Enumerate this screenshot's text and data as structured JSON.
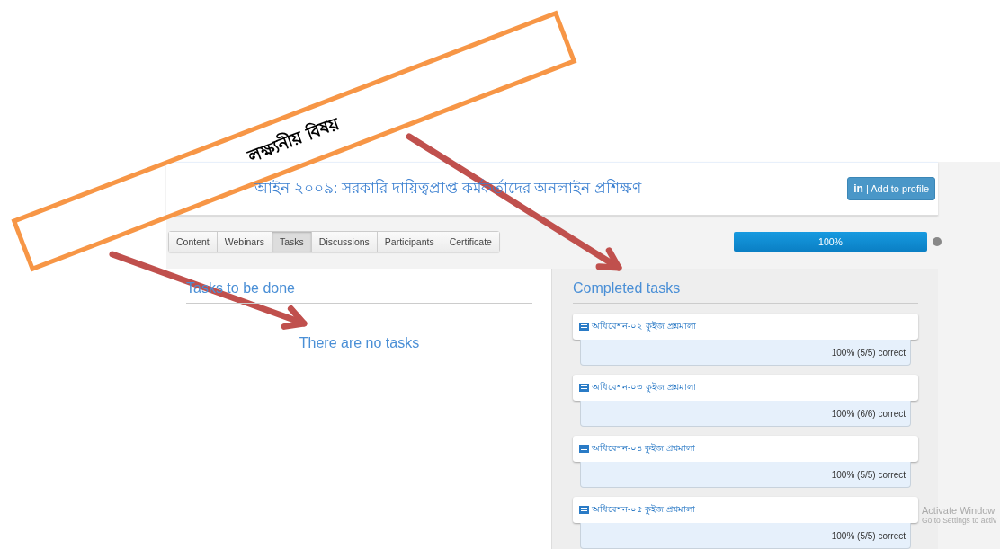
{
  "course": {
    "title": "আইন ২০০৯: সরকারি দায়িত্বপ্রাপ্ত কর্মকর্তাদের অনলাইন প্রশিক্ষণ",
    "profile_button": {
      "icon_text": "in",
      "label": "| Add to profile"
    }
  },
  "tabs": [
    {
      "label": "Content",
      "selected": false
    },
    {
      "label": "Webinars",
      "selected": false
    },
    {
      "label": "Tasks",
      "selected": true
    },
    {
      "label": "Discussions",
      "selected": false
    },
    {
      "label": "Participants",
      "selected": false
    },
    {
      "label": "Certificate",
      "selected": false
    }
  ],
  "progress": {
    "level": 1,
    "reading": "100%"
  },
  "todo": {
    "heading": "Tasks to be done",
    "empty_message": "There are no tasks"
  },
  "completed": {
    "heading": "Completed tasks",
    "items": [
      {
        "title": "অধিবেশন-০২ কুইজ প্রশ্নমালা",
        "result": "100% (5/5) correct"
      },
      {
        "title": "অধিবেশন-০৩ কুইজ প্রশ্নমালা",
        "result": "100% (6/6) correct"
      },
      {
        "title": "অধিবেশন-০৪ কুইজ প্রশ্নমালা",
        "result": "100% (5/5) correct"
      },
      {
        "title": "অধিবেশন-০৫ কুইজ প্রশ্নমালা",
        "result": "100% (5/5) correct"
      }
    ]
  },
  "annotation": {
    "label": "লক্ষ্যনীয় বিষয়"
  },
  "os_watermark": {
    "title": "Activate Window",
    "subtitle": "Go to Settings to activ"
  }
}
